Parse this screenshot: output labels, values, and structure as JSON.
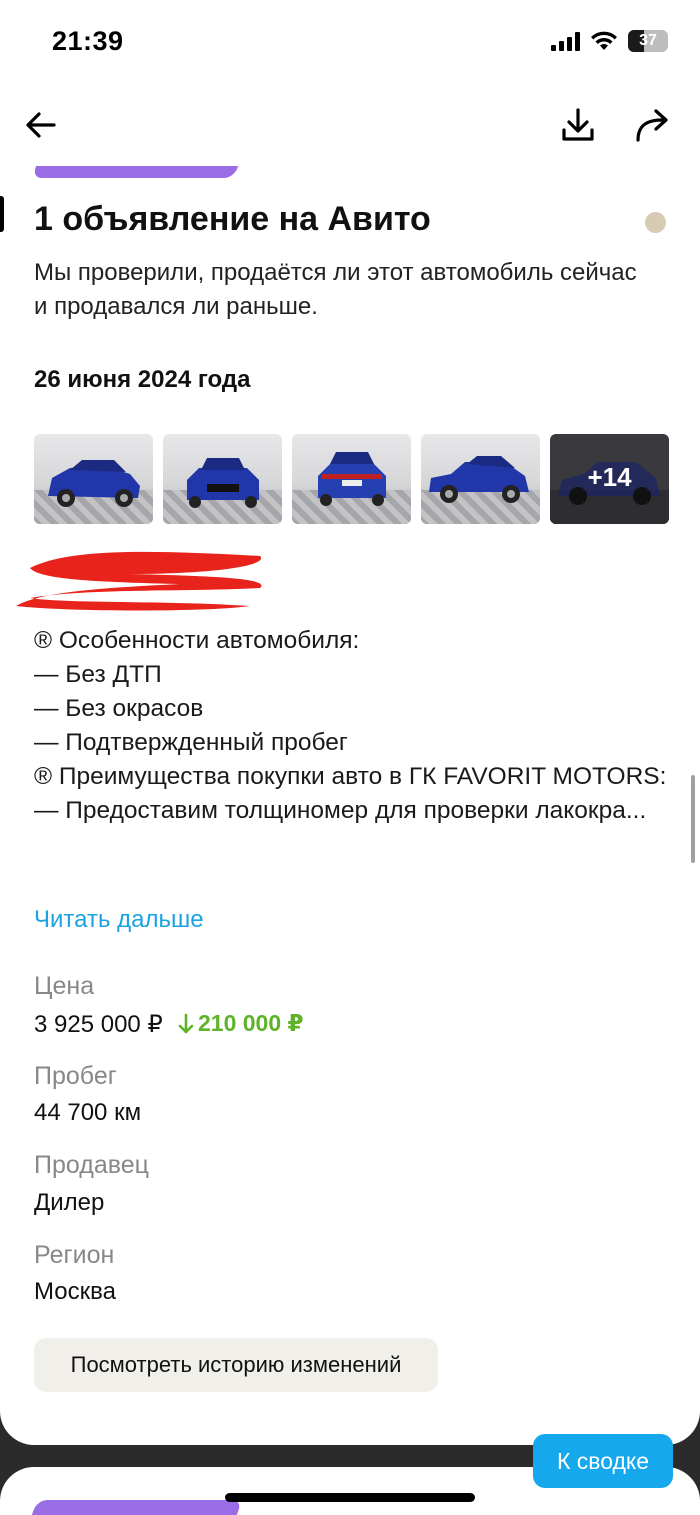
{
  "status_bar": {
    "time": "21:39",
    "battery": "37"
  },
  "nav": {
    "back_icon": "arrow-left-icon",
    "download_icon": "download-icon",
    "share_icon": "share-arrow-icon"
  },
  "section": {
    "title": "1 объявление на Авито",
    "description": "Мы проверили, продаётся ли этот автомобиль сейчас и продавался ли раньше.",
    "status_dot_color": "#d6cbb3",
    "tag_color": "#9a6ce6"
  },
  "listing": {
    "date": "26 июня 2024 года",
    "photos_more": "+14",
    "description_lines": [
      "® Особенности автомобиля:",
      "— Без ДТП",
      "— Без окрасов",
      "— Подтвержденный пробег",
      "® Преимущества покупки авто в ГК FAVORIT MOTORS:",
      "— Предоставим толщиномер для проверки лакокра..."
    ],
    "read_more": "Читать дальше",
    "price_label": "Цена",
    "price_value": "3 925 000 ₽",
    "price_drop": "210 000 ₽",
    "mileage_label": "Пробег",
    "mileage_value": "44 700 км",
    "seller_label": "Продавец",
    "seller_value": "Дилер",
    "region_label": "Регион",
    "region_value": "Москва",
    "history_button": "Посмотреть историю изменений"
  },
  "floating": {
    "to_summary": "К сводке",
    "accent": "#16a8ec"
  },
  "colors": {
    "price_drop": "#5fb329",
    "link": "#1aa3e0",
    "redaction": "#e8231b"
  }
}
